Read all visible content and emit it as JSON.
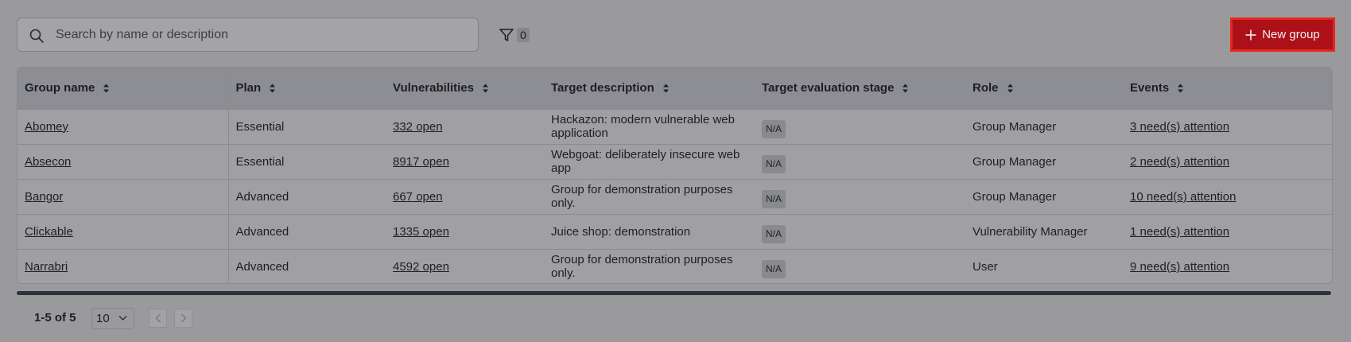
{
  "search": {
    "placeholder": "Search by name or description"
  },
  "filter": {
    "count": "0"
  },
  "new_group": {
    "label": "New group"
  },
  "table": {
    "columns": [
      "Group name",
      "Plan",
      "Vulnerabilities",
      "Target description",
      "Target evaluation stage",
      "Role",
      "Events"
    ],
    "rows": [
      {
        "name": "Abomey",
        "plan": "Essential",
        "vulns": "332 open",
        "desc": "Hackazon: modern vulnerable web application",
        "stage": "N/A",
        "role": "Group Manager",
        "events": "3 need(s) attention"
      },
      {
        "name": "Absecon",
        "plan": "Essential",
        "vulns": "8917 open",
        "desc": "Webgoat: deliberately insecure web app",
        "stage": "N/A",
        "role": "Group Manager",
        "events": "2 need(s) attention"
      },
      {
        "name": "Bangor",
        "plan": "Advanced",
        "vulns": "667 open",
        "desc": "Group for demonstration purposes only.",
        "stage": "N/A",
        "role": "Group Manager",
        "events": "10 need(s) attention"
      },
      {
        "name": "Clickable",
        "plan": "Advanced",
        "vulns": "1335 open",
        "desc": "Juice shop: demonstration",
        "stage": "N/A",
        "role": "Vulnerability Manager",
        "events": "1 need(s) attention"
      },
      {
        "name": "Narrabri",
        "plan": "Advanced",
        "vulns": "4592 open",
        "desc": "Group for demonstration purposes only.",
        "stage": "N/A",
        "role": "User",
        "events": "9 need(s) attention"
      }
    ]
  },
  "pagination": {
    "range": "1-5 of 5",
    "page_size": "10"
  },
  "colors": {
    "accent": "#ad1018",
    "accent_border": "#e8261e"
  }
}
